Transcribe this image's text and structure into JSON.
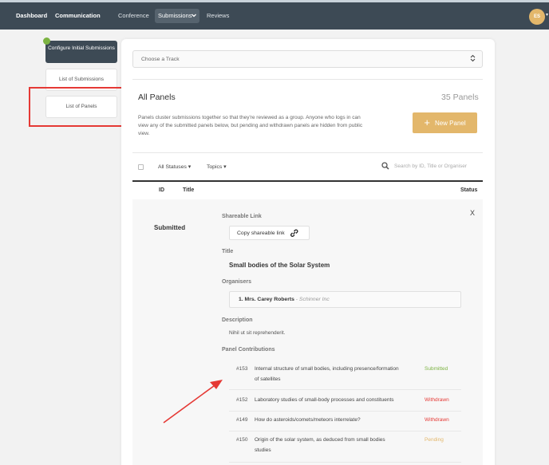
{
  "nav": {
    "dashboard": "Dashboard",
    "communication": "Communication",
    "conference": "Conference",
    "submissions": "Submissions",
    "reviews": "Reviews",
    "avatar_initials": "ES"
  },
  "sidebar": {
    "items": [
      {
        "label": "Configure Initial Submissions"
      },
      {
        "label": "List of Submissions"
      },
      {
        "label": "List of Panels"
      }
    ]
  },
  "main": {
    "track_placeholder": "Choose a Track",
    "title": "All Panels",
    "count": "35 Panels",
    "description": "Panels cluster submissions together so that they're reviewed as a group. Anyone who logs in can view any of the submitted panels below, but pending and withdrawn panels are hidden from public view.",
    "new_button": "New Panel",
    "filters": {
      "statuses": "All Statuses",
      "topics": "Topics"
    },
    "search_placeholder": "Search by ID, Title or Organiser",
    "columns": {
      "id": "ID",
      "title": "Title",
      "status": "Status"
    }
  },
  "panel": {
    "status": "Submitted",
    "close": "X",
    "shareable_label": "Shareable Link",
    "copy_button": "Copy shareable link",
    "title_label": "Title",
    "title_value": "Small bodies of the Solar System",
    "organisers_label": "Organisers",
    "organiser_name": "1. Mrs. Carey Roberts",
    "organiser_affiliation": " - Schinner Inc",
    "description_label": "Description",
    "description_value": "Nihil ut sit reprehenderit.",
    "contributions_label": "Panel Contributions",
    "contributions": [
      {
        "id": "#153",
        "title": "Internal structure of small bodies, including presence/formation of satellites",
        "status": "Submitted"
      },
      {
        "id": "#152",
        "title": "Laboratory studies of small-body processes and constituents",
        "status": "Withdrawn"
      },
      {
        "id": "#149",
        "title": "How do asteroids/comets/meteors interrelate?",
        "status": "Withdrawn"
      },
      {
        "id": "#150",
        "title": "Origin of the solar system, as deduced from small bodies studies",
        "status": "Pending"
      }
    ]
  },
  "colors": {
    "nav_bg": "#3d4a55",
    "accent": "#e3b76b",
    "submitted": "#7cb342",
    "withdrawn": "#e53935",
    "annotation": "#e53935"
  }
}
